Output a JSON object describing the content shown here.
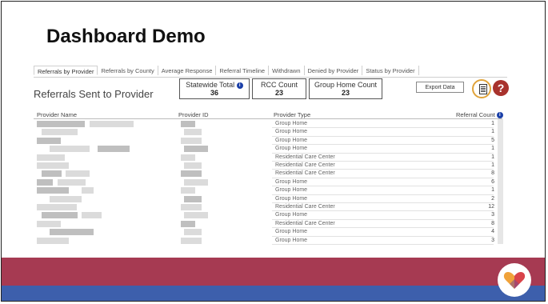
{
  "page": {
    "title": "Dashboard Demo"
  },
  "tabs": [
    "Referrals by Provider",
    "Referrals by County",
    "Average Response",
    "Referral Timeline",
    "Withdrawn",
    "Denied by Provider",
    "Status by Provider"
  ],
  "report": {
    "title": "Referrals Sent to Provider"
  },
  "kpis": {
    "statewide": {
      "label": "Statewide Total",
      "value": "36"
    },
    "rcc": {
      "label": "RCC Count",
      "value": "23"
    },
    "group_home": {
      "label": "Group Home Count",
      "value": "23"
    }
  },
  "toolbar": {
    "export_label": "Export Data",
    "help_glyph": "?",
    "info_glyph": "i"
  },
  "table": {
    "headers": {
      "provider_name": "Provider Name",
      "provider_id": "Provider ID",
      "provider_type": "Provider Type",
      "referral_count": "Referral Count"
    },
    "rows": [
      {
        "type": "Group Home",
        "count": "1"
      },
      {
        "type": "Group Home",
        "count": "1"
      },
      {
        "type": "Group Home",
        "count": "5"
      },
      {
        "type": "Group Home",
        "count": "1"
      },
      {
        "type": "Residential Care Center",
        "count": "1"
      },
      {
        "type": "Residential Care Center",
        "count": "1"
      },
      {
        "type": "Residential Care Center",
        "count": "8"
      },
      {
        "type": "Group Home",
        "count": "6"
      },
      {
        "type": "Group Home",
        "count": "1"
      },
      {
        "type": "Group Home",
        "count": "2"
      },
      {
        "type": "Residential Care Center",
        "count": "12"
      },
      {
        "type": "Group Home",
        "count": "3"
      },
      {
        "type": "Residential Care Center",
        "count": "8"
      },
      {
        "type": "Group Home",
        "count": "4"
      },
      {
        "type": "Group Home",
        "count": "3"
      }
    ]
  },
  "icons": {
    "report": "report-icon",
    "help": "help-icon",
    "info": "info-icon",
    "logo": "heart-logo-icon"
  },
  "colors": {
    "band_top": "#a63a52",
    "band_bottom": "#3d5fac",
    "help": "#a8322d",
    "info": "#1a3fa8",
    "report_ring": "#e0a33a"
  }
}
